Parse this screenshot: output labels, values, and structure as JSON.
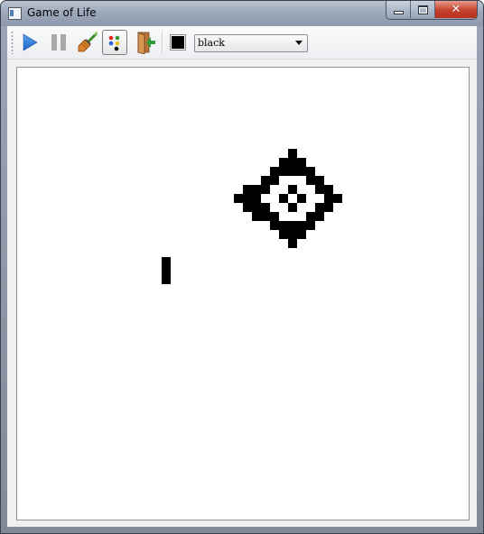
{
  "window": {
    "title": "Game of Life",
    "minimize_icon": "minimize-icon",
    "maximize_icon": "maximize-icon",
    "close_icon": "close-icon",
    "close_glyph": "✕"
  },
  "toolbar": {
    "buttons": [
      {
        "name": "play-button",
        "icon": "play-icon",
        "checked": false
      },
      {
        "name": "pause-button",
        "icon": "pause-icon",
        "checked": false
      },
      {
        "name": "clear-button",
        "icon": "broom-icon",
        "checked": false
      },
      {
        "name": "color-mode-button",
        "icon": "palette-dots-icon",
        "checked": true
      },
      {
        "name": "exit-button",
        "icon": "exit-door-icon",
        "checked": false
      }
    ],
    "color": {
      "selected": "black",
      "swatch_color": "#000000"
    }
  },
  "board": {
    "cell_color": "#000000",
    "background": "#ffffff",
    "live_cells": [
      [
        30,
        9
      ],
      [
        29,
        10
      ],
      [
        30,
        10
      ],
      [
        31,
        10
      ],
      [
        28,
        11
      ],
      [
        29,
        11
      ],
      [
        30,
        11
      ],
      [
        31,
        11
      ],
      [
        32,
        11
      ],
      [
        27,
        12
      ],
      [
        28,
        12
      ],
      [
        32,
        12
      ],
      [
        33,
        12
      ],
      [
        25,
        13
      ],
      [
        26,
        13
      ],
      [
        27,
        13
      ],
      [
        30,
        13
      ],
      [
        33,
        13
      ],
      [
        34,
        13
      ],
      [
        24,
        14
      ],
      [
        25,
        14
      ],
      [
        26,
        14
      ],
      [
        29,
        14
      ],
      [
        31,
        14
      ],
      [
        34,
        14
      ],
      [
        35,
        14
      ],
      [
        25,
        15
      ],
      [
        26,
        15
      ],
      [
        27,
        15
      ],
      [
        30,
        15
      ],
      [
        33,
        15
      ],
      [
        34,
        15
      ],
      [
        26,
        16
      ],
      [
        27,
        16
      ],
      [
        28,
        16
      ],
      [
        32,
        16
      ],
      [
        33,
        16
      ],
      [
        28,
        17
      ],
      [
        29,
        17
      ],
      [
        30,
        17
      ],
      [
        31,
        17
      ],
      [
        32,
        17
      ],
      [
        29,
        18
      ],
      [
        30,
        18
      ],
      [
        31,
        18
      ],
      [
        30,
        19
      ],
      [
        16,
        21
      ],
      [
        16,
        22
      ],
      [
        16,
        23
      ]
    ]
  }
}
